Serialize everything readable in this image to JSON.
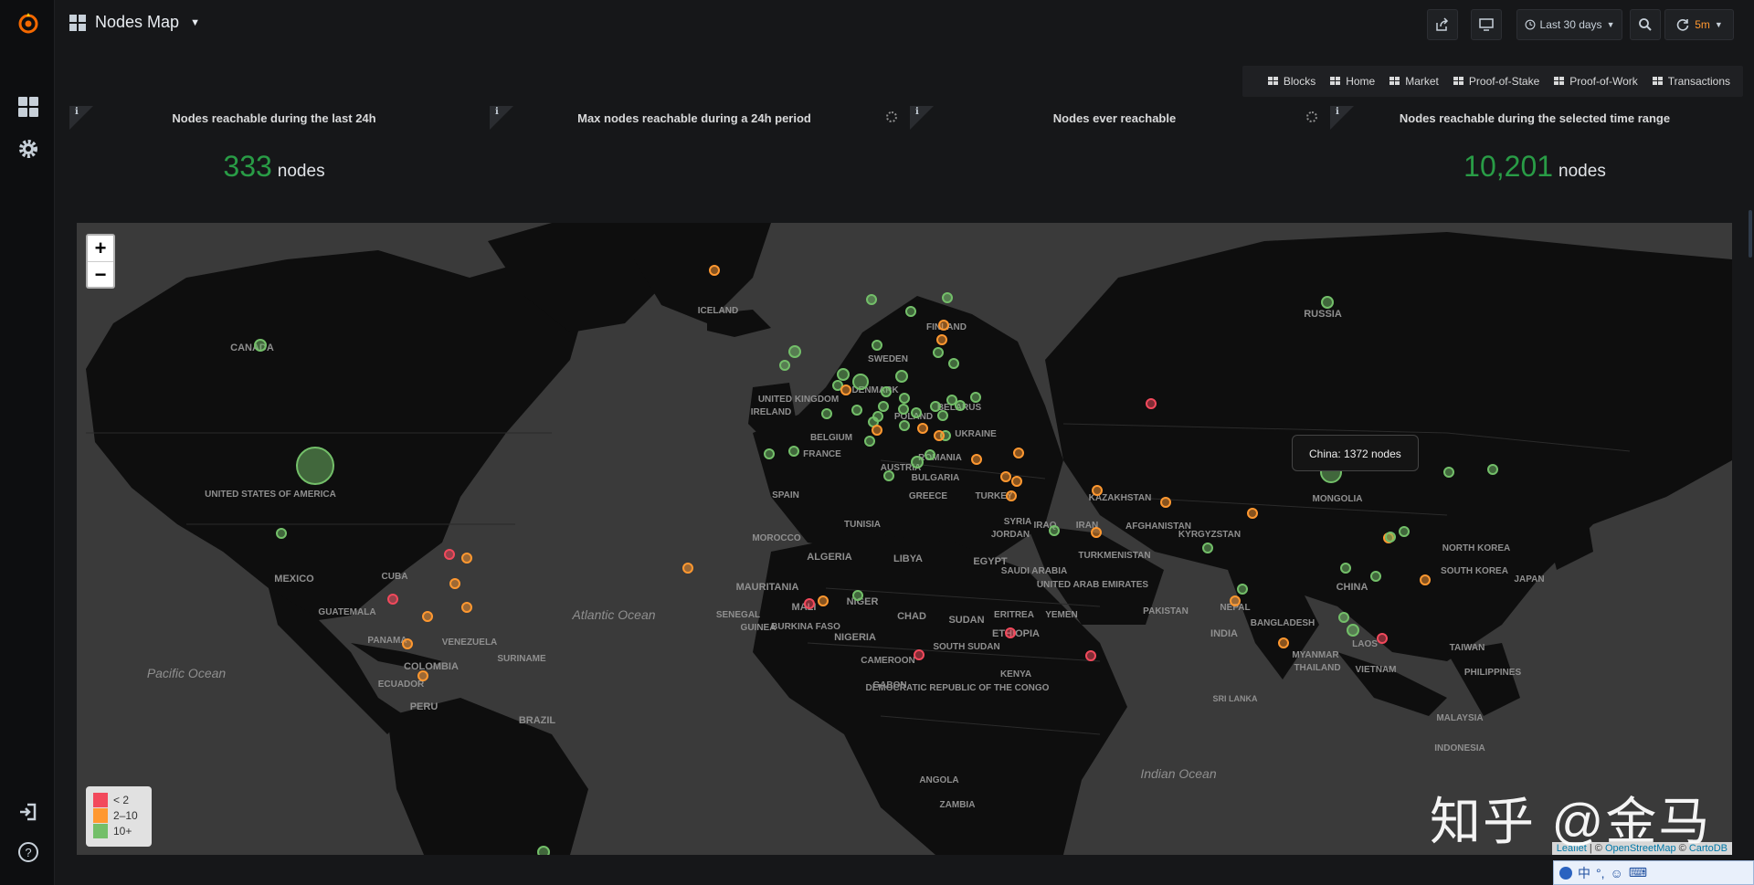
{
  "header": {
    "dashboard_title": "Nodes Map",
    "time_range": "Last 30 days",
    "refresh_interval": "5m"
  },
  "dashboard_links": [
    "Blocks",
    "Home",
    "Market",
    "Proof-of-Stake",
    "Proof-of-Work",
    "Transactions"
  ],
  "panels": [
    {
      "title": "Nodes reachable during the last 24h",
      "value": "333",
      "unit": "nodes"
    },
    {
      "title": "Max nodes reachable during a 24h period",
      "value": "",
      "unit": ""
    },
    {
      "title": "Nodes ever reachable",
      "value": "",
      "unit": ""
    },
    {
      "title": "Nodes reachable during the selected time range",
      "value": "10,201",
      "unit": "nodes"
    }
  ],
  "info_glyph": "i",
  "map": {
    "zoom_in": "+",
    "zoom_out": "−",
    "tooltip": "China: 1372 nodes",
    "legend": [
      {
        "label": "< 2",
        "color": "#f2495c"
      },
      {
        "label": "2–10",
        "color": "#ff9830"
      },
      {
        "label": "10+",
        "color": "#73bf69"
      }
    ],
    "attribution": {
      "leaflet": "Leaflet",
      "sep1": " | © ",
      "osm": "OpenStreetMap",
      "sep2": " © ",
      "carto": "CartoDB"
    },
    "labels": [
      "CANADA",
      "UNITED STATES OF AMERICA",
      "MEXICO",
      "CUBA",
      "GUATEMALA",
      "PANAMA",
      "VENEZUELA",
      "COLOMBIA",
      "SURINAME",
      "ECUADOR",
      "PERU",
      "BRAZIL",
      "Pacific Ocean",
      "Atlantic Ocean",
      "ICELAND",
      "IRELAND",
      "UNITED KINGDOM",
      "DENMARK",
      "SWEDEN",
      "FINLAND",
      "BELARUS",
      "POLAND",
      "UKRAINE",
      "FRANCE",
      "ROMANIA",
      "BULGARIA",
      "SPAIN",
      "GREECE",
      "TURKEY",
      "TUNISIA",
      "MOROCCO",
      "ALGERIA",
      "LIBYA",
      "EGYPT",
      "MAURITANIA",
      "MALI",
      "NIGER",
      "CHAD",
      "SUDAN",
      "SENEGAL",
      "GUINEA",
      "BURKINA FASO",
      "NIGERIA",
      "CAMEROON",
      "GABON",
      "DEMOCRATIC REPUBLIC OF THE CONGO",
      "SOUTH SUDAN",
      "ETHIOPIA",
      "ERITREA",
      "YEMEN",
      "KENYA",
      "ANGOLA",
      "ZAMBIA",
      "SAUDI ARABIA",
      "SYRIA",
      "JORDAN",
      "IRAQ",
      "IRAN",
      "UNITED ARAB EMIRATES",
      "TURKMENISTAN",
      "AFGHANISTAN",
      "PAKISTAN",
      "KAZAKHSTAN",
      "KYRGYZSTAN",
      "MONGOLIA",
      "RUSSIA",
      "CHINA",
      "NEPAL",
      "BANGLADESH",
      "INDIA",
      "SRI LANKA",
      "MYANMAR",
      "THAILAND",
      "LAOS",
      "VIETNAM",
      "MALAYSIA",
      "INDONESIA",
      "PHILIPPINES",
      "TAIWAN",
      "NORTH KOREA",
      "SOUTH KOREA",
      "JAPAN",
      "Indian Ocean",
      "AUSTRIA",
      "BELGIUM"
    ]
  },
  "watermark": "知乎 @金马",
  "tray": [
    "中",
    "°,",
    "☺",
    "⌨"
  ]
}
